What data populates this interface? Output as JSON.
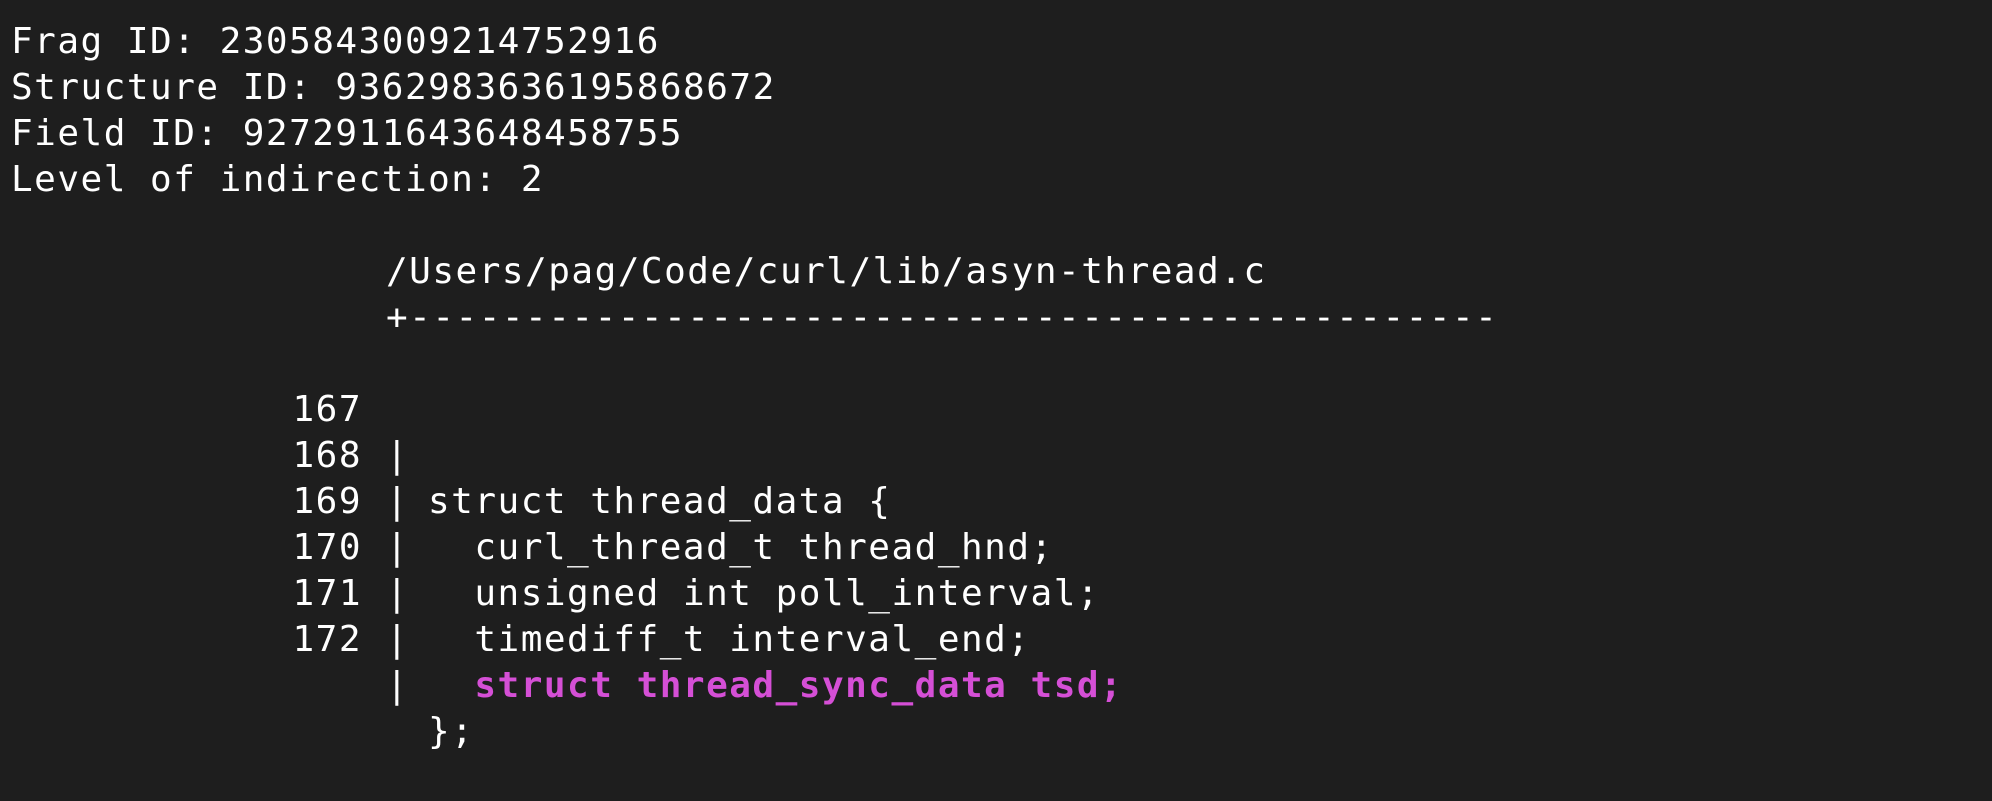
{
  "meta": {
    "frag_id": "Frag ID: 2305843009214752916",
    "structure_id": "Structure ID: 9362983636195868672",
    "field_id": "Field ID: 9272911643648458755",
    "level_of_indirection": "Level of indirection: 2"
  },
  "listing": {
    "file_path": "/Users/pag/Code/curl/lib/asyn-thread.c",
    "separator": "+-----------------------------------------------",
    "gutter_char": "|",
    "highlight_color": "#d54fd6",
    "lines": [
      {
        "number": "167",
        "code": "struct thread_data {"
      },
      {
        "number": "168",
        "code": "  curl_thread_t thread_hnd;"
      },
      {
        "number": "169",
        "code": "  unsigned int poll_interval;"
      },
      {
        "number": "170",
        "code": "  timediff_t interval_end;"
      },
      {
        "number": "171",
        "code": "  struct thread_sync_data tsd;",
        "highlighted": true
      },
      {
        "number": "172",
        "code": "};"
      }
    ]
  }
}
